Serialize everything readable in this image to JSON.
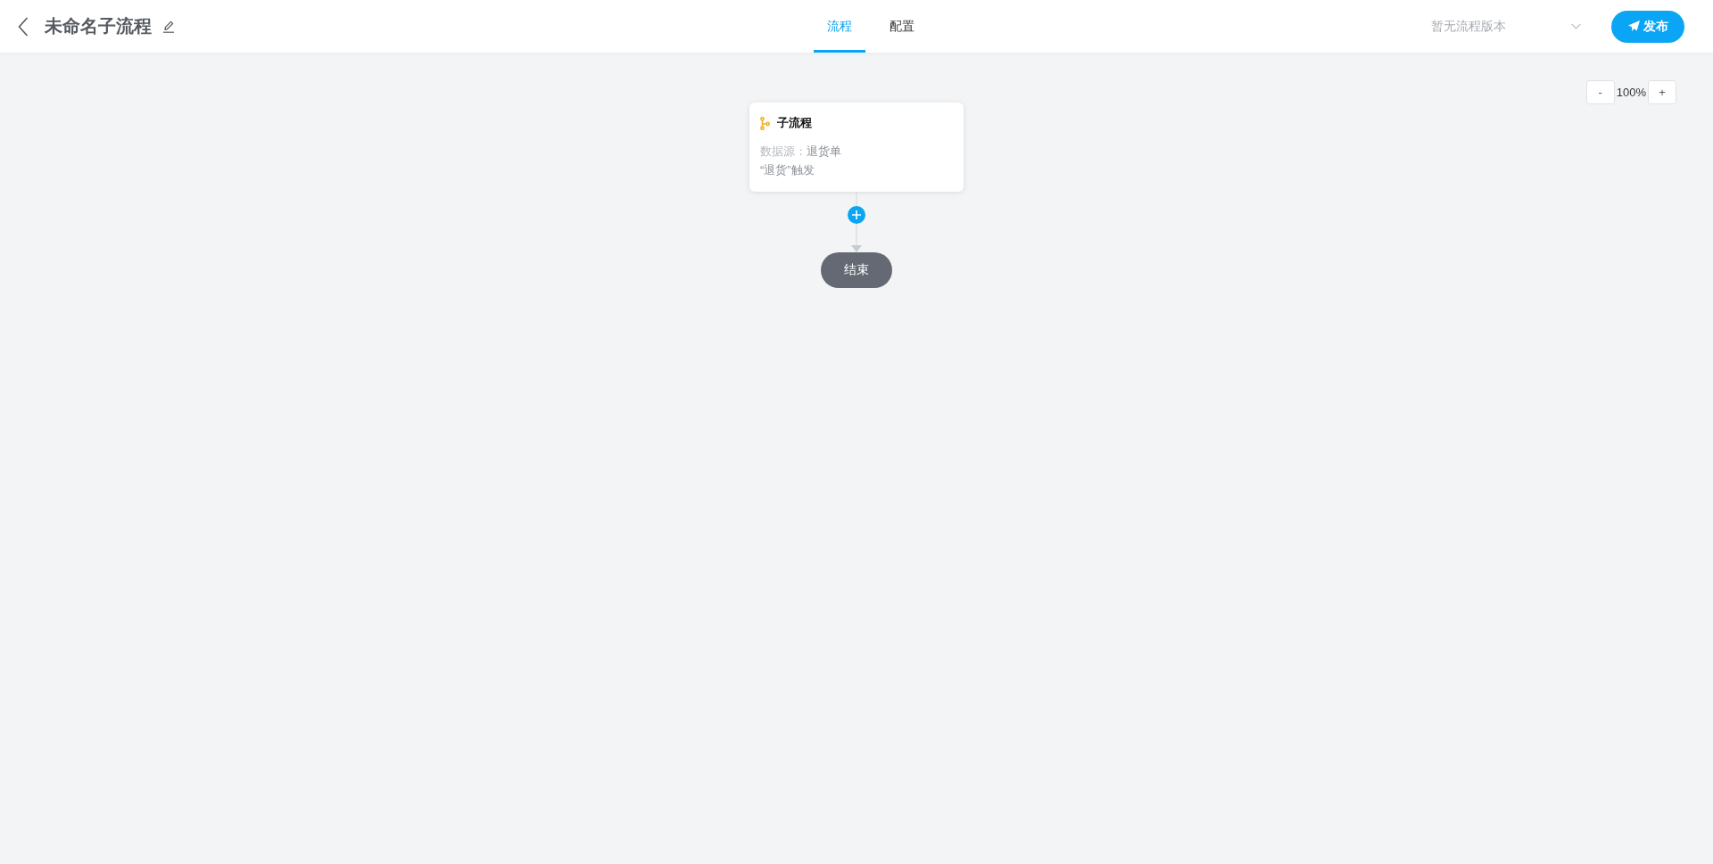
{
  "header": {
    "title": "未命名子流程",
    "tabs": [
      {
        "label": "流程",
        "selected": true
      },
      {
        "label": "配置",
        "selected": false
      }
    ],
    "version_select": {
      "placeholder": "暂无流程版本"
    },
    "publish_button": "发布"
  },
  "zoom": {
    "minus": "-",
    "level": "100%",
    "plus": "+"
  },
  "flow": {
    "nodes": [
      {
        "kind": "subprocess",
        "title": "子流程",
        "source_label": "数据源：",
        "source_value": "退货单",
        "trigger": "“退货”触发"
      },
      {
        "kind": "end",
        "label": "结束"
      }
    ]
  }
}
